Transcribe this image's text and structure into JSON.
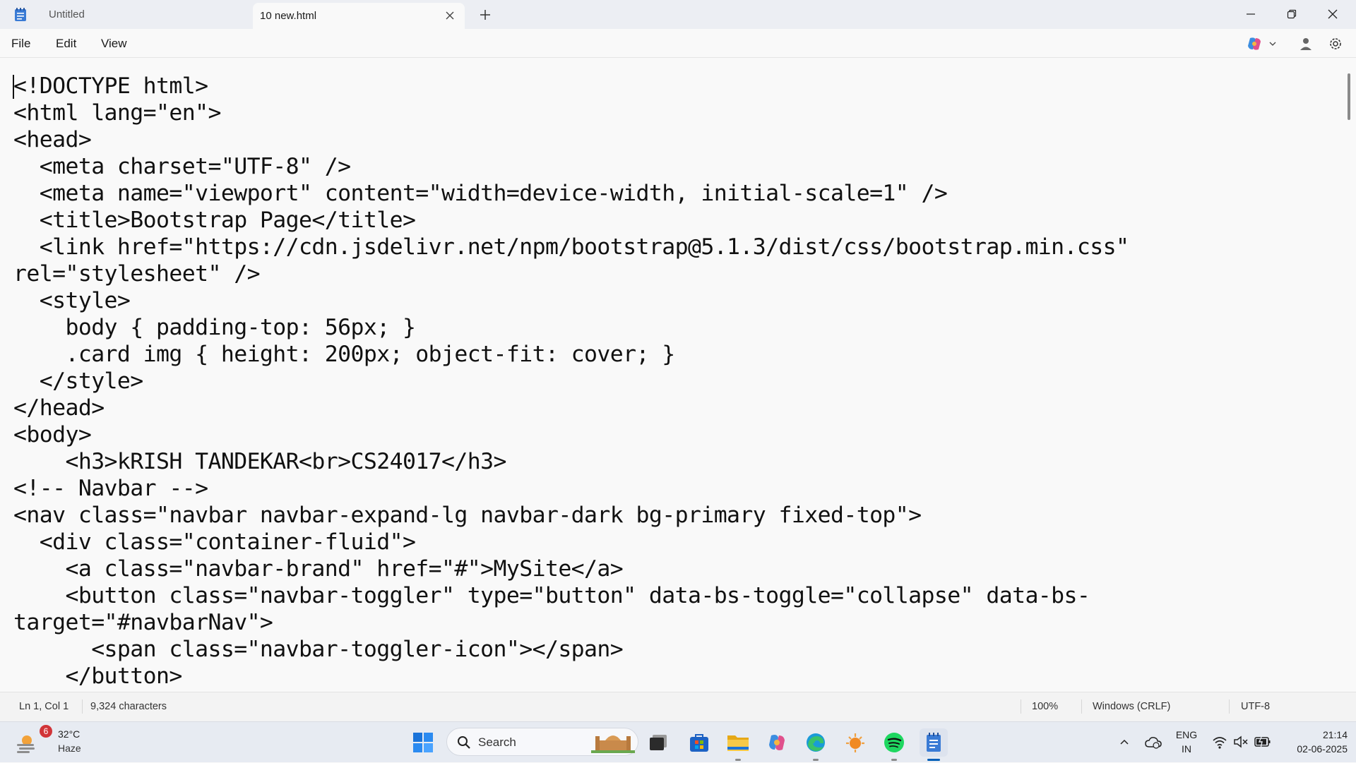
{
  "window": {
    "tabs": [
      {
        "label": "Untitled",
        "active": false
      },
      {
        "label": "10 new.html",
        "active": true
      }
    ],
    "controls": [
      "minimize-icon",
      "maximize-icon",
      "close-icon"
    ]
  },
  "menu": {
    "items": [
      "File",
      "Edit",
      "View"
    ],
    "right_icons": [
      "copilot-icon",
      "chevron-down-icon",
      "account-icon",
      "settings-icon"
    ]
  },
  "editor": {
    "lines": [
      "<!DOCTYPE html>",
      "<html lang=\"en\">",
      "<head>",
      "  <meta charset=\"UTF-8\" />",
      "  <meta name=\"viewport\" content=\"width=device-width, initial-scale=1\" />",
      "  <title>Bootstrap Page</title>",
      "  <link href=\"https://cdn.jsdelivr.net/npm/bootstrap@5.1.3/dist/css/bootstrap.min.css\"",
      "rel=\"stylesheet\" />",
      "  <style>",
      "    body { padding-top: 56px; }",
      "    .card img { height: 200px; object-fit: cover; }",
      "  </style>",
      "</head>",
      "<body>",
      "    <h3>kRISH TANDEKAR<br>CS24017</h3>",
      "<!-- Navbar -->",
      "<nav class=\"navbar navbar-expand-lg navbar-dark bg-primary fixed-top\">",
      "  <div class=\"container-fluid\">",
      "    <a class=\"navbar-brand\" href=\"#\">MySite</a>",
      "    <button class=\"navbar-toggler\" type=\"button\" data-bs-toggle=\"collapse\" data-bs-",
      "target=\"#navbarNav\">",
      "      <span class=\"navbar-toggler-icon\"></span>",
      "    </button>"
    ]
  },
  "status": {
    "position": "Ln 1, Col 1",
    "characters": "9,324 characters",
    "zoom": "100%",
    "line_ending": "Windows (CRLF)",
    "encoding": "UTF-8"
  },
  "taskbar": {
    "weather": {
      "temp": "32°C",
      "condition": "Haze",
      "badge": "6"
    },
    "search_placeholder": "Search",
    "pinned": [
      "start-icon",
      "search-icon",
      "task-view-icon",
      "store-icon",
      "file-explorer-icon",
      "copilot-icon",
      "edge-icon",
      "app-icon",
      "spotify-icon",
      "notepad-icon"
    ],
    "tray": {
      "language": "ENG",
      "region": "IN",
      "time": "21:14",
      "date": "02-06-2025"
    }
  }
}
